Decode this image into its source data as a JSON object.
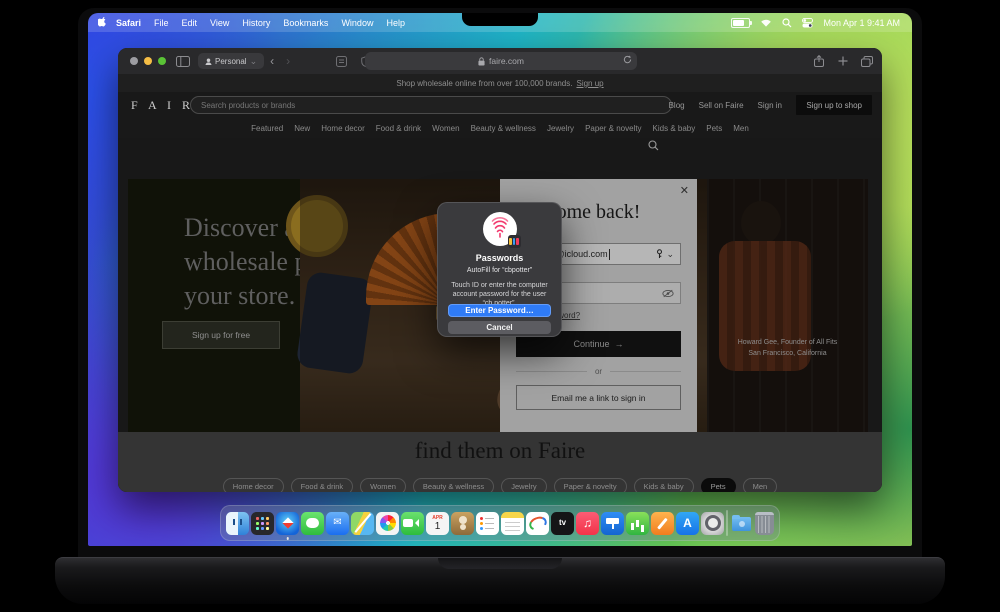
{
  "menu_bar": {
    "menus": [
      "Safari",
      "File",
      "Edit",
      "View",
      "History",
      "Bookmarks",
      "Window",
      "Help"
    ],
    "clock": "Mon Apr 1  9:41 AM"
  },
  "browser": {
    "profile_label": "Personal",
    "url": "faire.com"
  },
  "site": {
    "banner": {
      "text": "Shop wholesale online from over 100,000 brands.",
      "link": "Sign up"
    },
    "header": {
      "logo": "F A I R E",
      "search_placeholder": "Search products or brands",
      "links": [
        "Blog",
        "Sell on Faire",
        "Sign in"
      ],
      "signup_button": "Sign up to shop"
    },
    "nav": [
      "Featured",
      "New",
      "Home decor",
      "Food & drink",
      "Women",
      "Beauty & wellness",
      "Jewelry",
      "Paper & novelty",
      "Kids & baby",
      "Pets",
      "Men"
    ],
    "hero": {
      "headline_lines": [
        "Discover and",
        "wholesale pr",
        "your store."
      ],
      "cta": "Sign up for free",
      "caption_line1": "Howard Gee, Founder of All Fits",
      "caption_line2": "San Francisco, California"
    },
    "section": {
      "heading": "find them on Faire",
      "pills": [
        {
          "label": "Home decor"
        },
        {
          "label": "Food & drink"
        },
        {
          "label": "Women"
        },
        {
          "label": "Beauty & wellness"
        },
        {
          "label": "Jewelry"
        },
        {
          "label": "Paper & novelty"
        },
        {
          "label": "Kids & baby"
        },
        {
          "label": "Pets",
          "sel": true
        },
        {
          "label": "Men"
        }
      ]
    }
  },
  "signin_modal": {
    "title": "Welcome back!",
    "email_value": "cbpotter@icloud.com",
    "forgot_link": "Forgot password?",
    "continue_label": "Continue",
    "continue_arrow": "→",
    "or": "or",
    "email_link_button": "Email me a link to sign in"
  },
  "autofill_dialog": {
    "app": "Passwords",
    "subtitle": "AutoFill for “cbpotter”",
    "description": "Touch ID or enter the computer account password for the user “cb potter”.",
    "primary_button": "Enter Password…",
    "cancel_button": "Cancel",
    "accent_color": "#2f7bf6"
  },
  "dock": {
    "items": [
      {
        "name": "finder",
        "cls": "ic-finder",
        "dot": true
      },
      {
        "name": "launchpad",
        "cls": "ic-launchpad"
      },
      {
        "name": "safari",
        "cls": "ic-safari",
        "dot": true
      },
      {
        "name": "messages",
        "cls": "ic-messages"
      },
      {
        "name": "mail",
        "cls": "ic-mail",
        "text": "✉"
      },
      {
        "name": "maps",
        "cls": "ic-maps"
      },
      {
        "name": "photos",
        "cls": "ic-photos"
      },
      {
        "name": "facetime",
        "cls": "ic-facetime"
      },
      {
        "name": "calendar",
        "cls": "ic-calendar",
        "month": "APR",
        "day": "1"
      },
      {
        "name": "contacts",
        "cls": "ic-contacts"
      },
      {
        "name": "reminders",
        "cls": "ic-reminders"
      },
      {
        "name": "notes",
        "cls": "ic-notes"
      },
      {
        "name": "freeform",
        "cls": "ic-freeform"
      },
      {
        "name": "tv",
        "cls": "ic-tv",
        "text": "tv"
      },
      {
        "name": "music",
        "cls": "ic-music",
        "text": "♫"
      },
      {
        "name": "keynote",
        "cls": "ic-keynote"
      },
      {
        "name": "numbers",
        "cls": "ic-numbers"
      },
      {
        "name": "pages",
        "cls": "ic-pages"
      },
      {
        "name": "app-store",
        "cls": "ic-appstore",
        "text": "A"
      },
      {
        "name": "system-settings",
        "cls": "ic-settings"
      },
      {
        "name": "separator",
        "cls": "dock-sep"
      },
      {
        "name": "downloads-folder",
        "cls": "ic-folder"
      },
      {
        "name": "trash",
        "cls": "ic-trash"
      }
    ]
  }
}
